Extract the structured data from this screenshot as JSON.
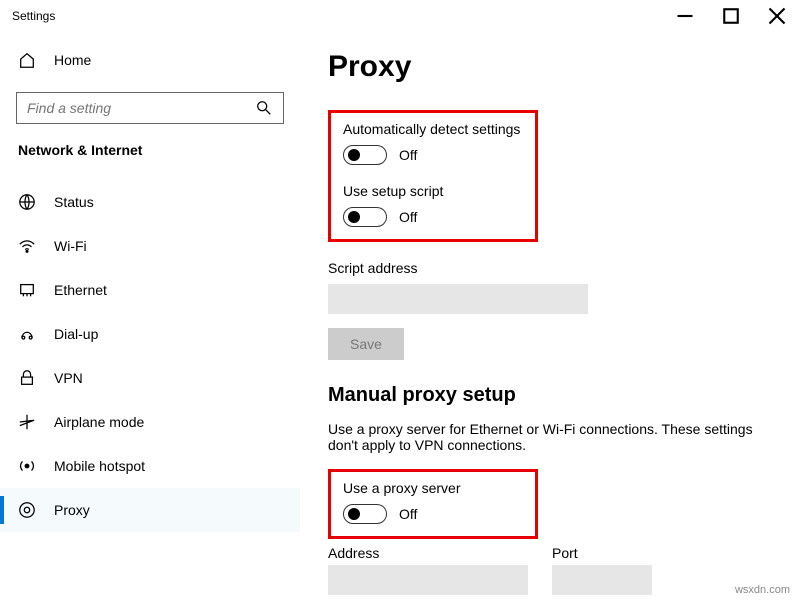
{
  "window": {
    "title": "Settings"
  },
  "sidebar": {
    "home": "Home",
    "search_placeholder": "Find a setting",
    "section": "Network & Internet",
    "items": [
      {
        "label": "Status"
      },
      {
        "label": "Wi-Fi"
      },
      {
        "label": "Ethernet"
      },
      {
        "label": "Dial-up"
      },
      {
        "label": "VPN"
      },
      {
        "label": "Airplane mode"
      },
      {
        "label": "Mobile hotspot"
      },
      {
        "label": "Proxy"
      }
    ]
  },
  "page": {
    "title": "Proxy",
    "auto_detect_label": "Automatically detect settings",
    "auto_detect_state": "Off",
    "setup_script_label": "Use setup script",
    "setup_script_state": "Off",
    "script_address_label": "Script address",
    "script_address_value": "",
    "save_label": "Save",
    "manual_heading": "Manual proxy setup",
    "manual_desc": "Use a proxy server for Ethernet or Wi-Fi connections. These settings don't apply to VPN connections.",
    "use_proxy_label": "Use a proxy server",
    "use_proxy_state": "Off",
    "address_label": "Address",
    "address_value": "",
    "port_label": "Port",
    "port_value": ""
  },
  "watermark": "wsxdn.com"
}
